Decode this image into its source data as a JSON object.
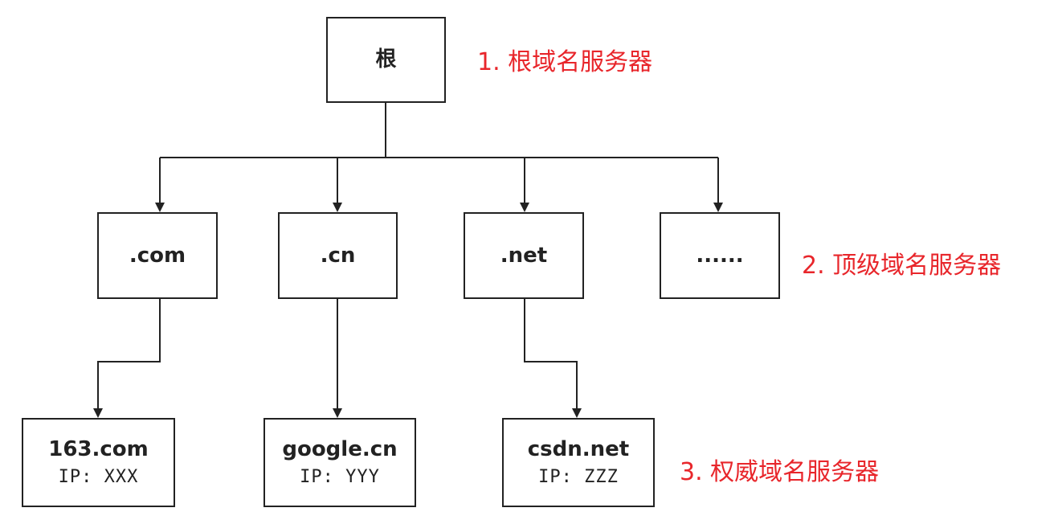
{
  "root": {
    "title": "根"
  },
  "tlds": [
    {
      "title": ".com"
    },
    {
      "title": ".cn"
    },
    {
      "title": ".net"
    },
    {
      "title": "......"
    }
  ],
  "authoritative": [
    {
      "title": "163.com",
      "ip": "IP: XXX"
    },
    {
      "title": "google.cn",
      "ip": "IP: YYY"
    },
    {
      "title": "csdn.net",
      "ip": "IP: ZZZ"
    }
  ],
  "labels": {
    "root": "1. 根域名服务器",
    "tld": "2. 顶级域名服务器",
    "authoritative": "3. 权威域名服务器"
  },
  "colors": {
    "line": "#222222",
    "label": "#e8262b"
  }
}
